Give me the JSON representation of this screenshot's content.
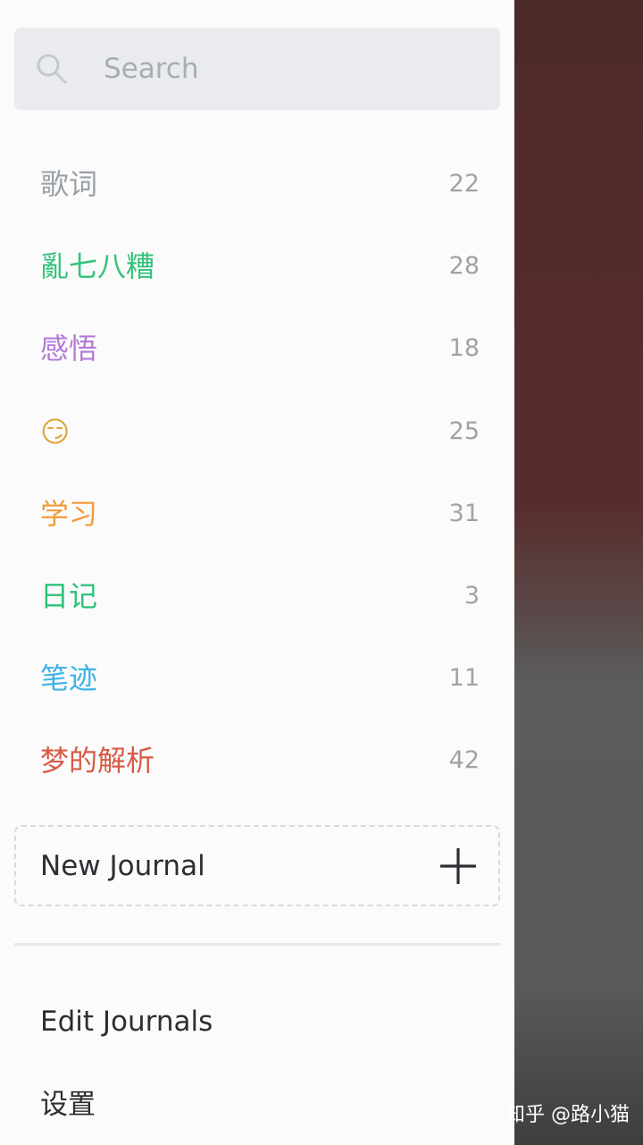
{
  "search": {
    "placeholder": "Search"
  },
  "journals": [
    {
      "name": "歌词",
      "count": "22",
      "color": "#9aa0a6"
    },
    {
      "name": "亂七八糟",
      "count": "28",
      "color": "#33c27a"
    },
    {
      "name": "感悟",
      "count": "18",
      "color": "#b37ad6"
    },
    {
      "name": "😏",
      "count": "25",
      "color": "#e0a23a"
    },
    {
      "name": "学习",
      "count": "31",
      "color": "#ef9b3b"
    },
    {
      "name": "日记",
      "count": "3",
      "color": "#2fc27c"
    },
    {
      "name": "笔迹",
      "count": "11",
      "color": "#41b3e6"
    },
    {
      "name": "梦的解析",
      "count": "42",
      "color": "#d85a45"
    }
  ],
  "new_journal": {
    "label": "New Journal"
  },
  "menu": {
    "edit_journals": "Edit Journals",
    "settings": "设置"
  },
  "watermark": "知乎 @路小猫"
}
